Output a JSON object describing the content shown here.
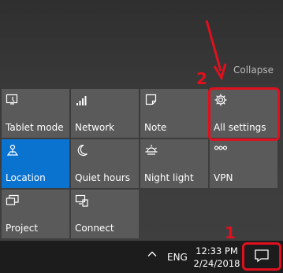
{
  "action_center": {
    "collapse_label": "Collapse",
    "tiles": [
      {
        "label": "Tablet mode",
        "icon": "tablet-mode-icon",
        "active": false
      },
      {
        "label": "Network",
        "icon": "network-icon",
        "active": false
      },
      {
        "label": "Note",
        "icon": "note-icon",
        "active": false
      },
      {
        "label": "All settings",
        "icon": "gear-icon",
        "active": false
      },
      {
        "label": "Location",
        "icon": "location-icon",
        "active": true
      },
      {
        "label": "Quiet hours",
        "icon": "moon-icon",
        "active": false
      },
      {
        "label": "Night light",
        "icon": "sun-icon",
        "active": false
      },
      {
        "label": "VPN",
        "icon": "vpn-icon",
        "active": false
      },
      {
        "label": "Project",
        "icon": "project-icon",
        "active": false
      },
      {
        "label": "Connect",
        "icon": "connect-icon",
        "active": false
      }
    ]
  },
  "annotations": {
    "step_1": "1",
    "step_2": "2",
    "color": "#e0101e"
  },
  "taskbar": {
    "language": "ENG",
    "time": "12:33 PM",
    "date": "2/24/2018"
  },
  "colors": {
    "tile": "#5a5a5a",
    "tile_active": "#0a73d0",
    "taskbar": "#1c1c1c"
  }
}
